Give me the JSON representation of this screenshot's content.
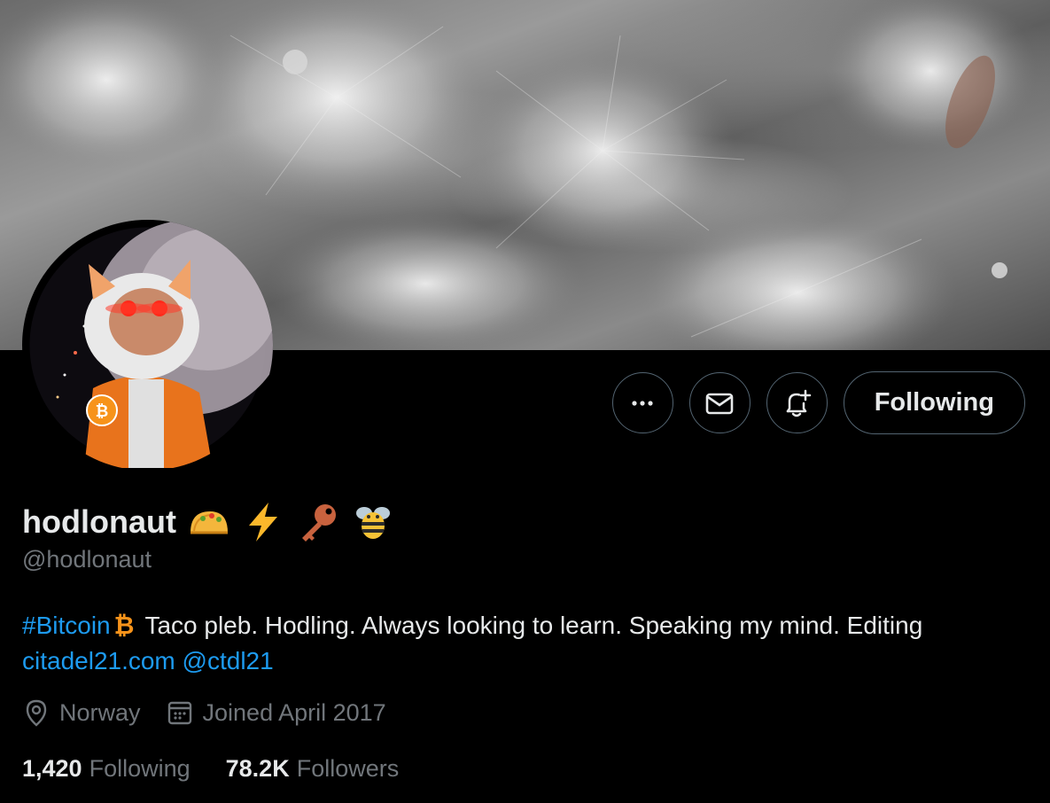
{
  "profile": {
    "display_name": "hodlonaut",
    "name_emojis": [
      "taco-emoji",
      "lightning-emoji",
      "key-emoji",
      "bee-emoji"
    ],
    "handle": "@hodlonaut",
    "bio": {
      "hashtag": "#Bitcoin",
      "btc_symbol": "₿",
      "text": "Taco pleb. Hodling. Always looking to learn. Speaking my mind. Editing",
      "link": "citadel21.com",
      "mention": "@ctdl21"
    },
    "location": "Norway",
    "joined": "Joined April 2017",
    "stats": {
      "following_count": "1,420",
      "following_label": "Following",
      "followers_count": "78.2K",
      "followers_label": "Followers"
    }
  },
  "actions": {
    "more_icon": "more-dots-icon",
    "message_icon": "envelope-icon",
    "notify_icon": "bell-plus-icon",
    "follow_label": "Following"
  },
  "colors": {
    "background": "#000000",
    "text_primary": "#e7e9ea",
    "text_secondary": "#71767b",
    "link": "#1d9bf0",
    "button_border": "#536471",
    "bitcoin_orange": "#f7931a"
  }
}
